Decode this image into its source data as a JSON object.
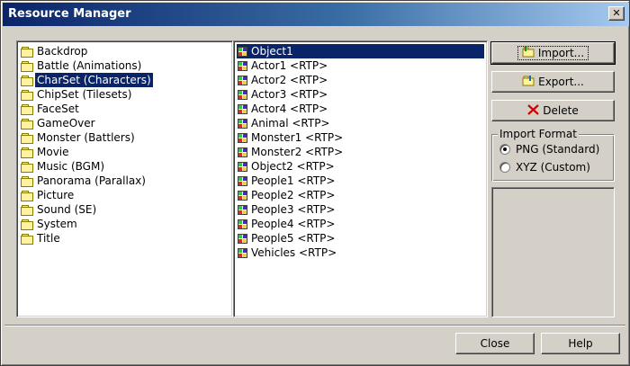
{
  "window": {
    "title": "Resource Manager",
    "close_glyph": "✕"
  },
  "categories": [
    {
      "label": "Backdrop",
      "selected": false
    },
    {
      "label": "Battle (Animations)",
      "selected": false
    },
    {
      "label": "CharSet (Characters)",
      "selected": true
    },
    {
      "label": "ChipSet (Tilesets)",
      "selected": false
    },
    {
      "label": "FaceSet",
      "selected": false
    },
    {
      "label": "GameOver",
      "selected": false
    },
    {
      "label": "Monster (Battlers)",
      "selected": false
    },
    {
      "label": "Movie",
      "selected": false
    },
    {
      "label": "Music (BGM)",
      "selected": false
    },
    {
      "label": "Panorama (Parallax)",
      "selected": false
    },
    {
      "label": "Picture",
      "selected": false
    },
    {
      "label": "Sound (SE)",
      "selected": false
    },
    {
      "label": "System",
      "selected": false
    },
    {
      "label": "Title",
      "selected": false
    }
  ],
  "files": [
    {
      "label": "Object1",
      "selected": true
    },
    {
      "label": "Actor1 <RTP>",
      "selected": false
    },
    {
      "label": "Actor2 <RTP>",
      "selected": false
    },
    {
      "label": "Actor3 <RTP>",
      "selected": false
    },
    {
      "label": "Actor4 <RTP>",
      "selected": false
    },
    {
      "label": "Animal <RTP>",
      "selected": false
    },
    {
      "label": "Monster1 <RTP>",
      "selected": false
    },
    {
      "label": "Monster2 <RTP>",
      "selected": false
    },
    {
      "label": "Object2 <RTP>",
      "selected": false
    },
    {
      "label": "People1 <RTP>",
      "selected": false
    },
    {
      "label": "People2 <RTP>",
      "selected": false
    },
    {
      "label": "People3 <RTP>",
      "selected": false
    },
    {
      "label": "People4 <RTP>",
      "selected": false
    },
    {
      "label": "People5 <RTP>",
      "selected": false
    },
    {
      "label": "Vehicles <RTP>",
      "selected": false
    }
  ],
  "actions": {
    "import_label": "Import...",
    "export_label": "Export...",
    "delete_label": "Delete",
    "import_icon": "folder-import-icon",
    "export_icon": "folder-export-icon",
    "delete_icon": "red-x-delete-icon"
  },
  "import_format": {
    "title": "Import Format",
    "options": [
      {
        "label": "PNG (Standard)",
        "checked": true
      },
      {
        "label": "XYZ (Custom)",
        "checked": false
      }
    ]
  },
  "footer": {
    "close_label": "Close",
    "help_label": "Help"
  },
  "colors": {
    "selection": "#0a246a",
    "titlebar_start": "#0a246a",
    "titlebar_end": "#a6caf0",
    "face": "#d4d0c8",
    "delete_x": "#d40000"
  }
}
